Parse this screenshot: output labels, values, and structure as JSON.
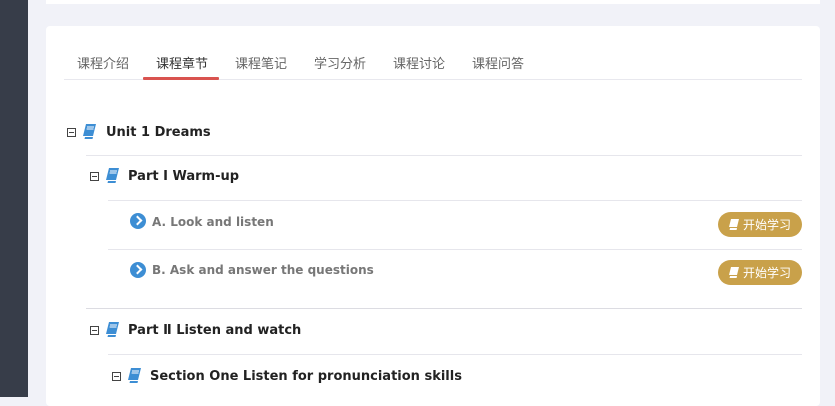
{
  "tabs": [
    {
      "label": "课程介绍"
    },
    {
      "label": "课程章节"
    },
    {
      "label": "课程笔记"
    },
    {
      "label": "学习分析"
    },
    {
      "label": "课程讨论"
    },
    {
      "label": "课程问答"
    }
  ],
  "active_tab": "课程章节",
  "chapters": {
    "unit": {
      "title": "Unit 1 Dreams"
    },
    "part1": {
      "title": "Part Ⅰ Warm-up"
    },
    "items": [
      {
        "label": "A. Look and listen",
        "button": "开始学习"
      },
      {
        "label": "B. Ask and answer the questions",
        "button": "开始学习"
      }
    ],
    "part2": {
      "title": "Part Ⅱ Listen and watch"
    },
    "section1": {
      "title": "Section One Listen for pronunciation skills"
    }
  },
  "colors": {
    "accent_underline": "#d9534f",
    "button_gold": "#c9a14a",
    "icon_blue": "#3d8ed4",
    "sidebar": "#373d49"
  }
}
